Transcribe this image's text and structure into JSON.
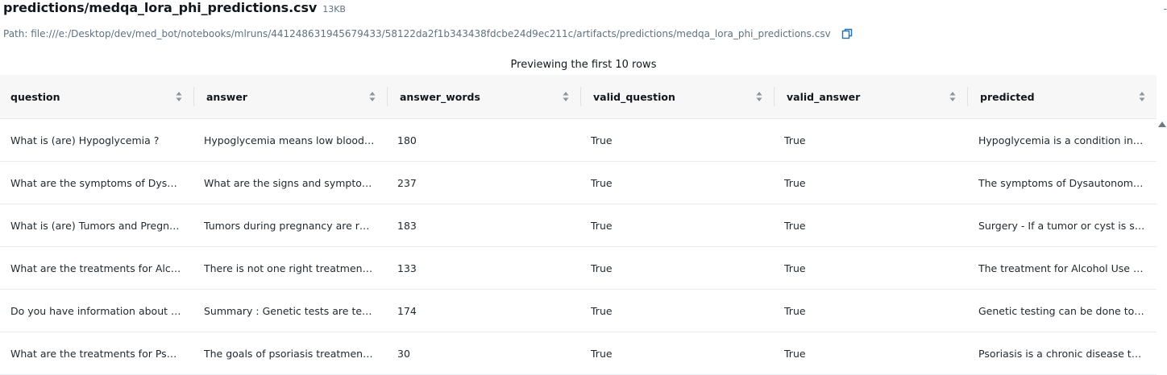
{
  "file": {
    "title": "predictions/medqa_lora_phi_predictions.csv",
    "size": "13KB",
    "path": "Path: file:///e:/Desktop/dev/med_bot/notebooks/mlruns/441248631945679433/58122da2f1b343438fdcbe24d9ec211c/artifacts/predictions/medqa_lora_phi_predictions.csv",
    "edge_mark": "-"
  },
  "preview_note": "Previewing the first 10 rows",
  "columns": [
    "question",
    "answer",
    "answer_words",
    "valid_question",
    "valid_answer",
    "predicted"
  ],
  "rows": [
    [
      "What is (are) Hypoglycemia ?",
      "Hypoglycemia means low blood gl...",
      "180",
      "True",
      "True",
      "Hypoglycemia is a condition in wh..."
    ],
    [
      "What are the symptoms of Dysaut...",
      "What are the signs and symptoms...",
      "237",
      "True",
      "True",
      "The symptoms of Dysautonomia li..."
    ],
    [
      "What is (are) Tumors and Pregnan...",
      "Tumors during pregnancy are rare...",
      "183",
      "True",
      "True",
      "Surgery - If a tumor or cyst is susp..."
    ],
    [
      "What are the treatments for Alcoh...",
      "There is not one right treatment f...",
      "133",
      "True",
      "True",
      "The treatment for Alcohol Use and..."
    ],
    [
      "Do you have information about G...",
      "Summary : Genetic tests are tests ...",
      "174",
      "True",
      "True",
      "Genetic testing can be done to dia..."
    ],
    [
      "What are the treatments for Psoria...",
      "The goals of psoriasis treatment ar...",
      "30",
      "True",
      "True",
      "Psoriasis is a chronic disease that ..."
    ]
  ],
  "icons": {
    "copy": "copy-icon",
    "sort": "sort-icon",
    "scroll_up": "scroll-up-arrow-icon"
  },
  "colors": {
    "accent": "#2272b4",
    "header_bg": "#f7f7f7",
    "border": "#e8ecef",
    "muted_text": "#5f7281"
  }
}
